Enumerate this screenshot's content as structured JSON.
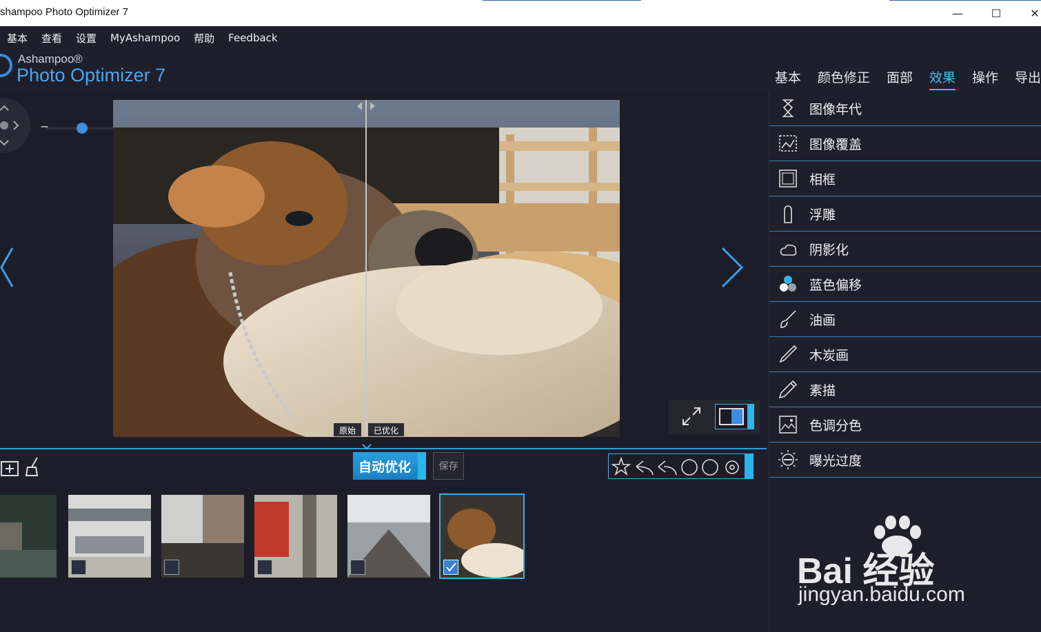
{
  "window": {
    "title": "shampoo Photo Optimizer 7",
    "controls": {
      "minimize": "—",
      "maximize": "☐",
      "close": "✕"
    }
  },
  "menu": [
    "基本",
    "查看",
    "设置",
    "MyAshampoo",
    "帮助",
    "Feedback"
  ],
  "logo": {
    "brand": "Ashampoo®",
    "product": "Photo Optimizer 7"
  },
  "tabs": [
    {
      "label": "基本",
      "active": false
    },
    {
      "label": "颜色修正",
      "active": false
    },
    {
      "label": "面部",
      "active": false
    },
    {
      "label": "效果",
      "active": true
    },
    {
      "label": "操作",
      "active": false
    },
    {
      "label": "导出",
      "active": false
    }
  ],
  "viewer": {
    "zoom": {
      "minus": "−",
      "plus": "+",
      "level": 0.38
    },
    "compare_left": "原始",
    "compare_right": "已优化"
  },
  "toolbar": {
    "auto_label": "自动优化",
    "save_label": "保存"
  },
  "effects": [
    {
      "label": "图像年代",
      "icon": "hourglass-icon"
    },
    {
      "label": "图像覆盖",
      "icon": "overlay-icon"
    },
    {
      "label": "相框",
      "icon": "frame-icon"
    },
    {
      "label": "浮雕",
      "icon": "emboss-icon"
    },
    {
      "label": "阴影化",
      "icon": "shadow-icon"
    },
    {
      "label": "蓝色偏移",
      "icon": "blue-shift-icon"
    },
    {
      "label": "油画",
      "icon": "brush-icon"
    },
    {
      "label": "木炭画",
      "icon": "charcoal-icon"
    },
    {
      "label": "素描",
      "icon": "pencil-icon"
    },
    {
      "label": "色调分色",
      "icon": "posterize-icon"
    },
    {
      "label": "曝光过度",
      "icon": "overexpose-icon"
    }
  ],
  "watermark": {
    "brand": "Bai 经验",
    "url": "jingyan.baidu.com"
  },
  "colors": {
    "accent": "#3ab0e6",
    "background": "#1f1f2b",
    "logo": "#4aa6f0"
  }
}
